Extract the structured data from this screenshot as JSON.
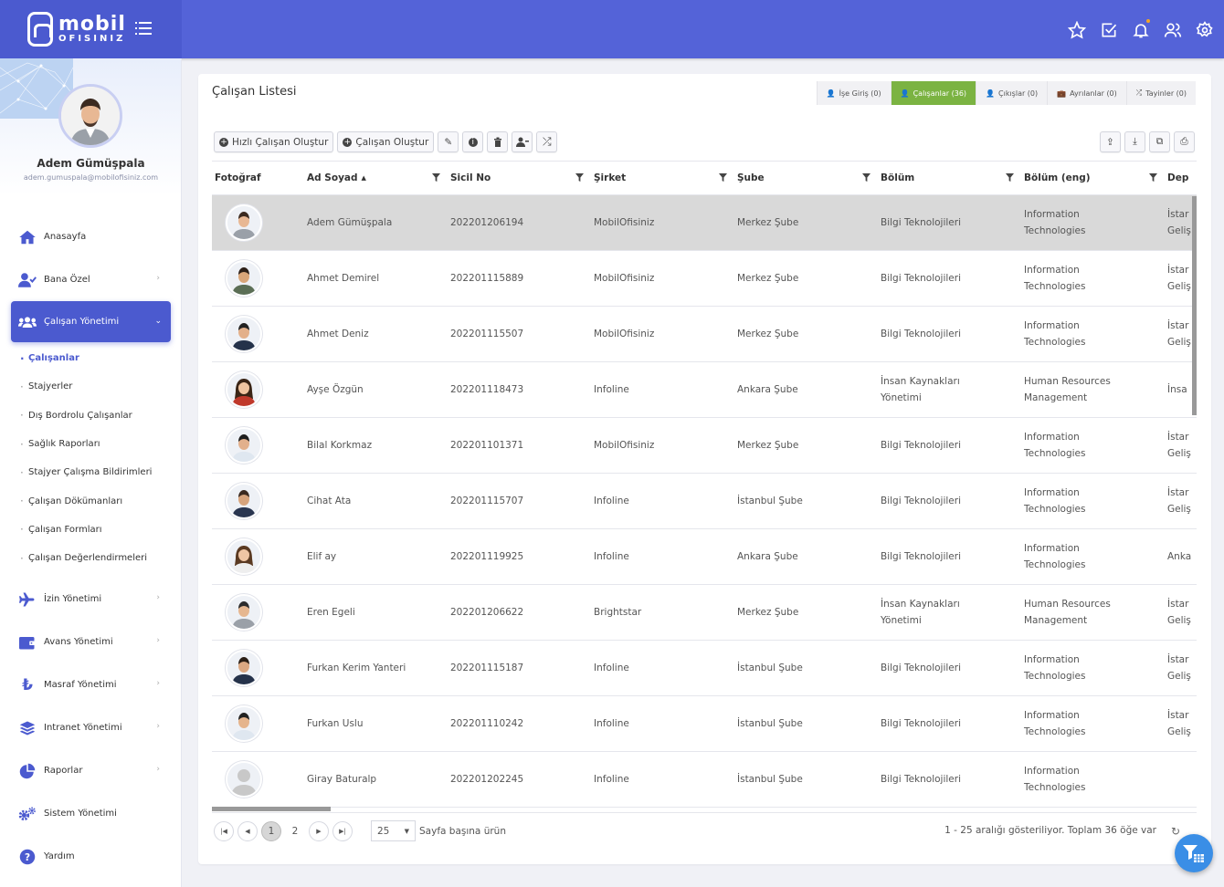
{
  "brand": {
    "name_top": "mobil",
    "name_bottom": "OFISINIZ"
  },
  "header_icons": [
    "star-icon",
    "check-square-icon",
    "bell-icon",
    "users-icon",
    "settings-icon"
  ],
  "profile": {
    "name": "Adem Gümüşpala",
    "email": "adem.gumuspala@mobilofisiniz.com"
  },
  "menu": [
    {
      "label": "Anasayfa",
      "icon": "home-icon"
    },
    {
      "label": "Bana Özel",
      "icon": "user-check-icon"
    },
    {
      "label": "Çalışan Yönetimi",
      "icon": "users-icon"
    },
    {
      "label": "İzin Yönetimi",
      "icon": "plane-icon"
    },
    {
      "label": "Avans Yönetimi",
      "icon": "wallet-icon"
    },
    {
      "label": "Masraf Yönetimi",
      "icon": "lira-icon"
    },
    {
      "label": "Intranet Yönetimi",
      "icon": "layers-icon"
    },
    {
      "label": "Raporlar",
      "icon": "pie-chart-icon"
    },
    {
      "label": "Sistem Yönetimi",
      "icon": "cogs-icon"
    },
    {
      "label": "Yardım",
      "icon": "help-icon"
    }
  ],
  "submenu": [
    "Çalışanlar",
    "Stajyerler",
    "Dış Bordrolu Çalışanlar",
    "Sağlık Raporları",
    "Stajyer Çalışma Bildirimleri",
    "Çalışan Dökümanları",
    "Çalışan Formları",
    "Çalışan Değerlendirmeleri"
  ],
  "page": {
    "title": "Çalışan Listesi"
  },
  "tabs": [
    "İşe Giriş (0)",
    "Çalışanlar (36)",
    "Çıkışlar (0)",
    "Ayrılanlar (0)",
    "Tayinler (0)"
  ],
  "toolbar": {
    "quick_create": "Hızlı Çalışan Oluştur",
    "create": "Çalışan Oluştur"
  },
  "columns": [
    "Fotoğraf",
    "Ad Soyad",
    "Sicil No",
    "Şirket",
    "Şube",
    "Bölüm",
    "Bölüm (eng)",
    "Dep"
  ],
  "sort_indicator": "▲",
  "rows": [
    {
      "name": "Adem Gümüşpala",
      "sicil": "202201206194",
      "sirket": "MobilOfisiniz",
      "sube": "Merkez Şube",
      "bolum": "Bilgi Teknolojileri",
      "bolum_eng": "Information Technologies",
      "dep": "İstar Geliş",
      "selected": true
    },
    {
      "name": "Ahmet Demirel",
      "sicil": "202201115889",
      "sirket": "MobilOfisiniz",
      "sube": "Merkez Şube",
      "bolum": "Bilgi Teknolojileri",
      "bolum_eng": "Information Technologies",
      "dep": "İstar Geliş"
    },
    {
      "name": "Ahmet Deniz",
      "sicil": "202201115507",
      "sirket": "MobilOfisiniz",
      "sube": "Merkez Şube",
      "bolum": "Bilgi Teknolojileri",
      "bolum_eng": "Information Technologies",
      "dep": "İstar Geliş"
    },
    {
      "name": "Ayşe Özgün",
      "sicil": "202201118473",
      "sirket": "Infoline",
      "sube": "Ankara Şube",
      "bolum": "İnsan Kaynakları Yönetimi",
      "bolum_eng": "Human Resources Management",
      "dep": "İnsa"
    },
    {
      "name": "Bilal Korkmaz",
      "sicil": "202201101371",
      "sirket": "MobilOfisiniz",
      "sube": "Merkez Şube",
      "bolum": "Bilgi Teknolojileri",
      "bolum_eng": "Information Technologies",
      "dep": "İstar Geliş"
    },
    {
      "name": "Cihat Ata",
      "sicil": "202201115707",
      "sirket": "Infoline",
      "sube": "İstanbul Şube",
      "bolum": "Bilgi Teknolojileri",
      "bolum_eng": "Information Technologies",
      "dep": "İstar Geliş"
    },
    {
      "name": "Elif ay",
      "sicil": "202201119925",
      "sirket": "Infoline",
      "sube": "Ankara Şube",
      "bolum": "Bilgi Teknolojileri",
      "bolum_eng": "Information Technologies",
      "dep": "Anka"
    },
    {
      "name": "Eren Egeli",
      "sicil": "202201206622",
      "sirket": "Brightstar",
      "sube": "Merkez Şube",
      "bolum": "İnsan Kaynakları Yönetimi",
      "bolum_eng": "Human Resources Management",
      "dep": "İstar Geliş"
    },
    {
      "name": "Furkan Kerim Yanteri",
      "sicil": "202201115187",
      "sirket": "Infoline",
      "sube": "İstanbul Şube",
      "bolum": "Bilgi Teknolojileri",
      "bolum_eng": "Information Technologies",
      "dep": "İstar Geliş"
    },
    {
      "name": "Furkan Uslu",
      "sicil": "202201110242",
      "sirket": "Infoline",
      "sube": "İstanbul Şube",
      "bolum": "Bilgi Teknolojileri",
      "bolum_eng": "Information Technologies",
      "dep": "İstar Geliş"
    },
    {
      "name": "Giray Baturalp",
      "sicil": "202201202245",
      "sirket": "Infoline",
      "sube": "İstanbul Şube",
      "bolum": "Bilgi Teknolojileri",
      "bolum_eng": "Information Technologies",
      "dep": ""
    }
  ],
  "pager": {
    "pages": [
      "1",
      "2"
    ],
    "page_size": "25",
    "per_page_label": "Sayfa başına ürün",
    "info": "1 - 25 aralığı gösteriliyor. Toplam 36 öğe var"
  },
  "colors": {
    "primary": "#5463d8",
    "active_tab": "#7bb342",
    "selected_row": "#d9d9d9"
  }
}
